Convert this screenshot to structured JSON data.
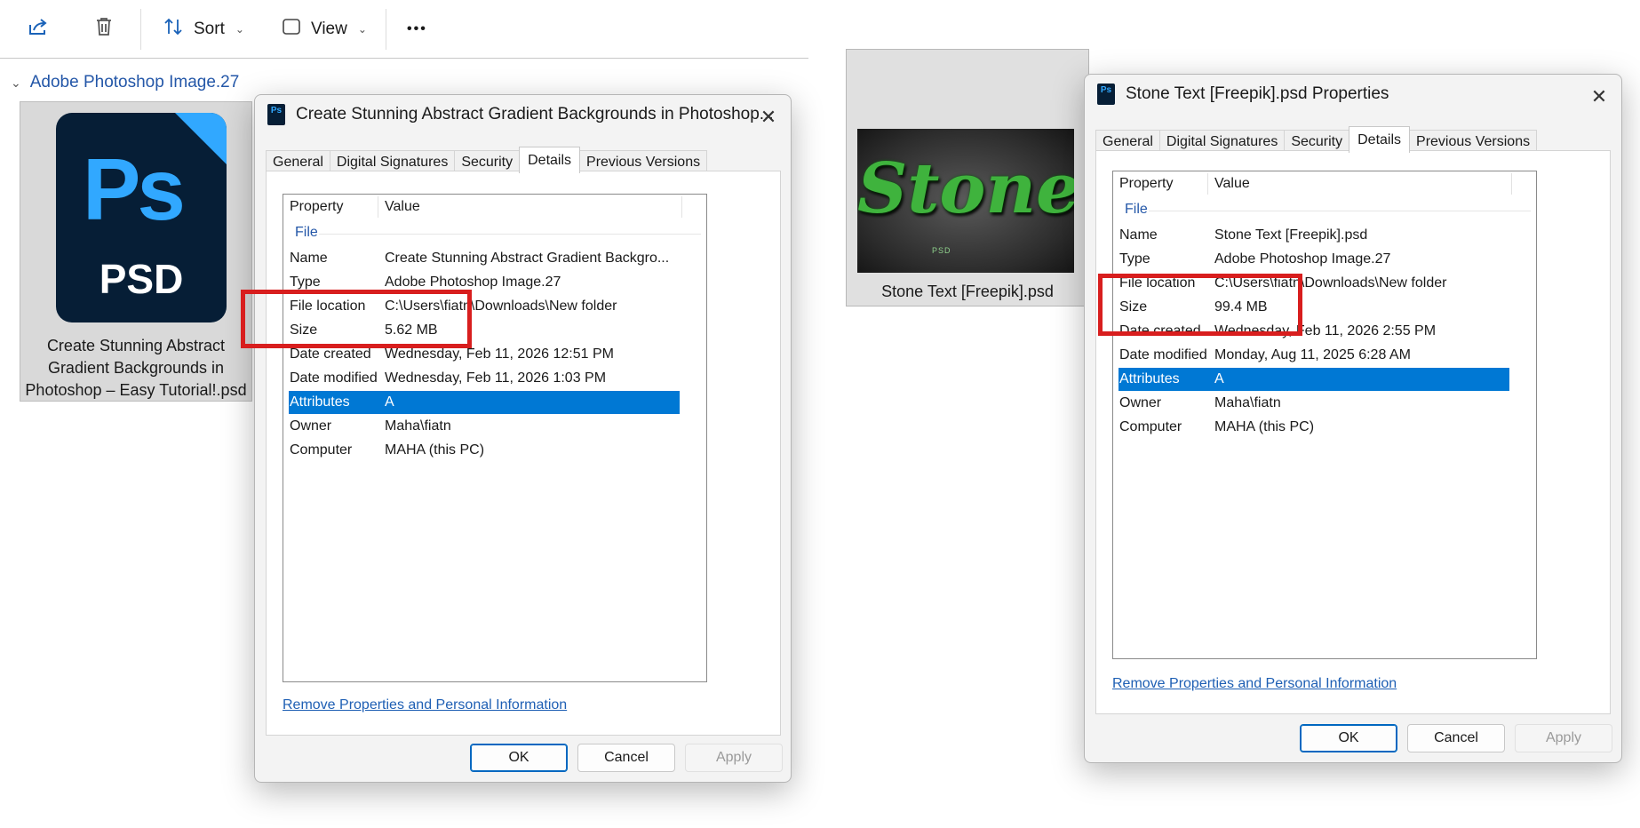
{
  "toolbar": {
    "sort_label": "Sort",
    "view_label": "View",
    "more_label": "•••"
  },
  "group": {
    "label": "Adobe Photoshop Image.27"
  },
  "file_tile": {
    "icon_ps": "Ps",
    "icon_psd": "PSD",
    "caption_lines": [
      "Create Stunning Abstract",
      "Gradient Backgrounds in",
      "Photoshop – Easy Tutorial!.psd"
    ]
  },
  "thumb_tile": {
    "image_word": "Stone",
    "image_sub": "PSD",
    "caption": "Stone Text [Freepik].psd"
  },
  "dialog_left": {
    "icon_text": "Ps",
    "title": "Create Stunning Abstract Gradient Backgrounds in Photoshop...",
    "tabs": [
      "General",
      "Digital Signatures",
      "Security",
      "Details",
      "Previous Versions"
    ],
    "active_tab": "Details",
    "col_property": "Property",
    "col_value": "Value",
    "group_label": "File",
    "rows": [
      {
        "key": "Name",
        "value": "Create Stunning Abstract Gradient Backgro..."
      },
      {
        "key": "Type",
        "value": "Adobe Photoshop Image.27"
      },
      {
        "key": "File location",
        "value": "C:\\Users\\fiatn\\Downloads\\New folder"
      },
      {
        "key": "Size",
        "value": "5.62 MB"
      },
      {
        "key": "Date created",
        "value": "Wednesday, Feb 11, 2026 12:51 PM"
      },
      {
        "key": "Date modified",
        "value": "Wednesday, Feb 11, 2026 1:03 PM"
      },
      {
        "key": "Attributes",
        "value": "A"
      },
      {
        "key": "Owner",
        "value": "Maha\\fiatn"
      },
      {
        "key": "Computer",
        "value": "MAHA (this PC)"
      }
    ],
    "remove_link": "Remove Properties and Personal Information",
    "ok": "OK",
    "cancel": "Cancel",
    "apply": "Apply"
  },
  "dialog_right": {
    "icon_text": "Ps",
    "title": "Stone Text [Freepik].psd Properties",
    "tabs": [
      "General",
      "Digital Signatures",
      "Security",
      "Details",
      "Previous Versions"
    ],
    "active_tab": "Details",
    "col_property": "Property",
    "col_value": "Value",
    "group_label": "File",
    "rows": [
      {
        "key": "Name",
        "value": "Stone Text [Freepik].psd"
      },
      {
        "key": "Type",
        "value": "Adobe Photoshop Image.27"
      },
      {
        "key": "File location",
        "value": "C:\\Users\\fiatn\\Downloads\\New folder"
      },
      {
        "key": "Size",
        "value": "99.4 MB"
      },
      {
        "key": "Date created",
        "value": "Wednesday, Feb 11, 2026 2:55 PM"
      },
      {
        "key": "Date modified",
        "value": "Monday, Aug 11, 2025 6:28 AM"
      },
      {
        "key": "Attributes",
        "value": "A"
      },
      {
        "key": "Owner",
        "value": "Maha\\fiatn"
      },
      {
        "key": "Computer",
        "value": "MAHA (this PC)"
      }
    ],
    "remove_link": "Remove Properties and Personal Information",
    "ok": "OK",
    "cancel": "Cancel",
    "apply": "Apply"
  },
  "colors": {
    "selection": "#0078d4",
    "highlight_box": "#d81e1e",
    "ps_blue": "#31a8ff",
    "ps_navy": "#061e36",
    "link": "#1e5fb4"
  }
}
